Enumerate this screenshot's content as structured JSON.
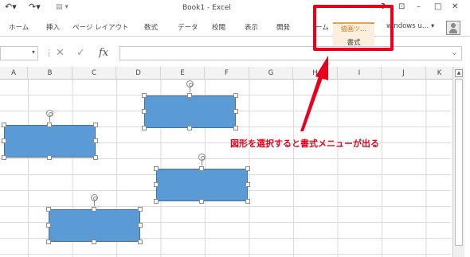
{
  "window": {
    "title": "Book1 - Excel",
    "help": "?",
    "restore": "⊡",
    "minimize": "–",
    "maximize": "□",
    "close": "✕"
  },
  "quick_access": {
    "undo": "↶▾",
    "redo": "↷▾",
    "customize": "▤ ▾"
  },
  "ribbon": {
    "tabs": [
      "ホーム",
      "挿入",
      "ページ レイアウト",
      "数式",
      "データ",
      "校閲",
      "表示",
      "開発",
      "ーム"
    ],
    "contextual_group": "描画ツ…",
    "contextual_tab": "書式",
    "user": "windows u… ▾"
  },
  "formula_bar": {
    "namebox_value": "",
    "namebox_arrow": "▾",
    "separator": "⋮",
    "cancel": "✕",
    "enter": "✓",
    "function": "fx",
    "formula_value": "",
    "expand": "⌄"
  },
  "columns": [
    "A",
    "B",
    "C",
    "D",
    "E",
    "F",
    "G",
    "H",
    "I",
    "J",
    "K"
  ],
  "scrollbar": {
    "up": "▲"
  },
  "annotation": {
    "text": "図形を選択すると書式メニューが出る",
    "color": "#e8001c"
  },
  "colors": {
    "shape_fill": "#5b9bd5",
    "shape_border": "#41719c",
    "contextual_tab_fill": "#fdeedd",
    "contextual_accent": "#e3a24d"
  }
}
